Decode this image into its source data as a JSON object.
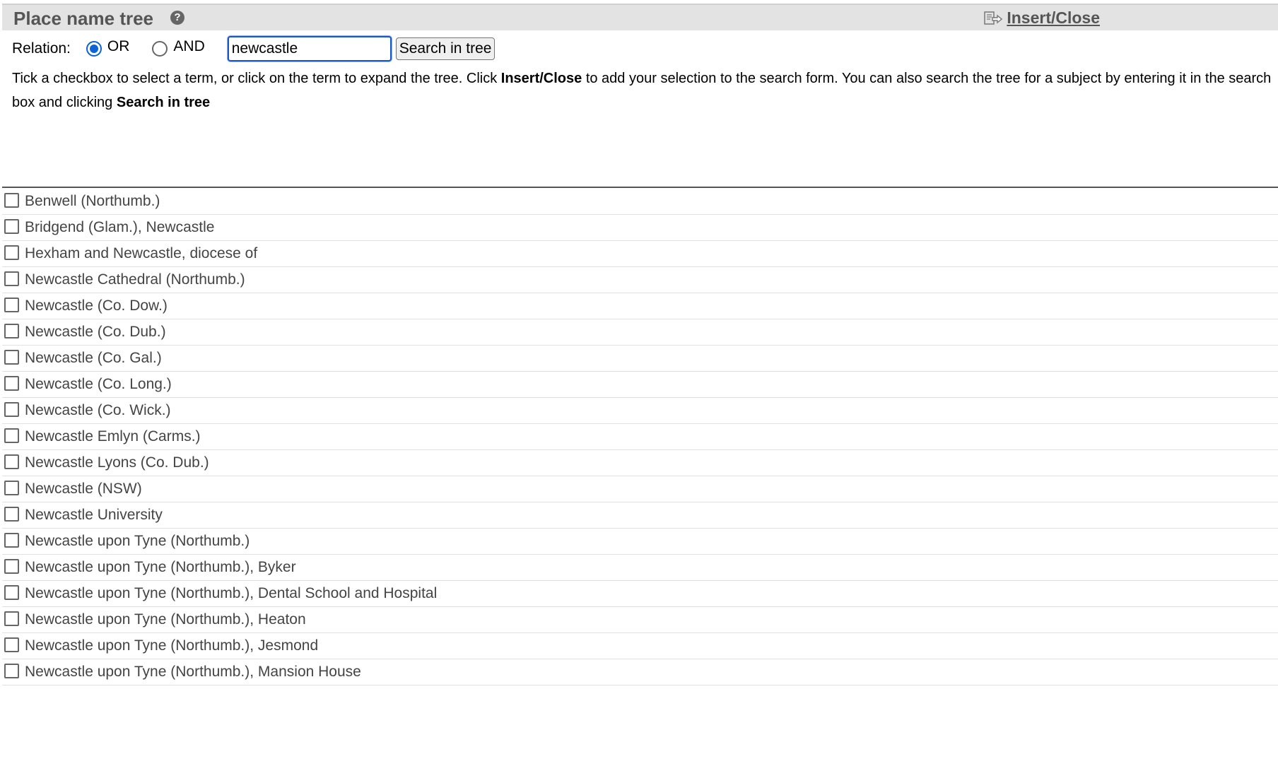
{
  "header": {
    "title": "Place name tree",
    "help_icon": "?",
    "insert_close_label": "Insert/Close"
  },
  "relation": {
    "label": "Relation:",
    "options": [
      {
        "label": "OR",
        "checked": true
      },
      {
        "label": "AND",
        "checked": false
      }
    ]
  },
  "search": {
    "value": "newcastle",
    "button_label": "Search in tree"
  },
  "instructions": {
    "part1": "Tick a checkbox to select a term, or click on the term to expand the tree. Click ",
    "bold1": "Insert/Close",
    "part2": " to add your selection to the search form. You can also search the tree for a subject by entering it in the search box and clicking ",
    "bold2": "Search in tree"
  },
  "tree": {
    "items": [
      "Benwell (Northumb.)",
      "Bridgend (Glam.), Newcastle",
      "Hexham and Newcastle, diocese of",
      "Newcastle Cathedral (Northumb.)",
      "Newcastle (Co. Dow.)",
      "Newcastle (Co. Dub.)",
      "Newcastle (Co. Gal.)",
      "Newcastle (Co. Long.)",
      "Newcastle (Co. Wick.)",
      "Newcastle Emlyn (Carms.)",
      "Newcastle Lyons (Co. Dub.)",
      "Newcastle (NSW)",
      "Newcastle University",
      "Newcastle upon Tyne (Northumb.)",
      "Newcastle upon Tyne (Northumb.), Byker",
      "Newcastle upon Tyne (Northumb.), Dental School and Hospital",
      "Newcastle upon Tyne (Northumb.), Heaton",
      "Newcastle upon Tyne (Northumb.), Jesmond",
      "Newcastle upon Tyne (Northumb.), Mansion House"
    ]
  },
  "colors": {
    "accent": "#0b62d9",
    "header_bg": "#e3e3e3",
    "header_text": "#555555",
    "term_text": "#444444"
  }
}
